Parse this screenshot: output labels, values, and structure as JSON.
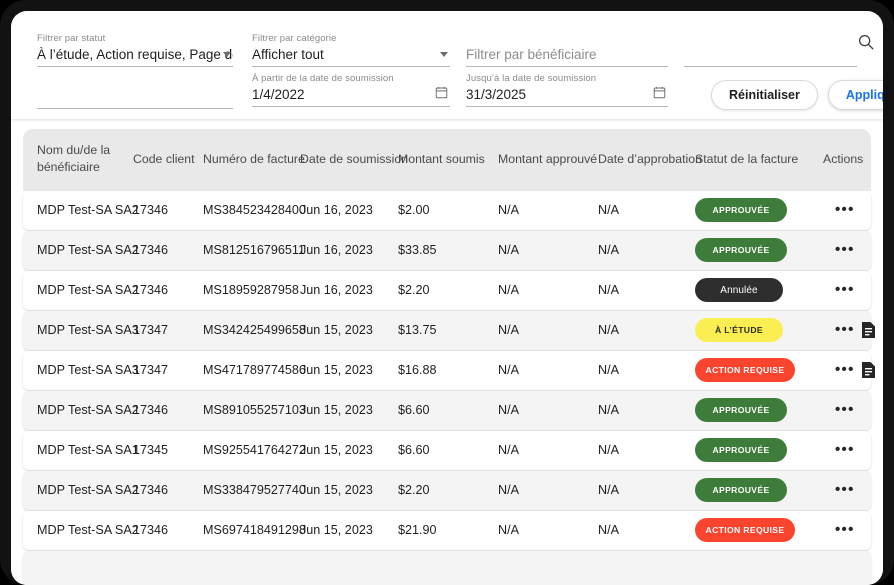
{
  "filters": {
    "status": {
      "label": "Filtrer par statut",
      "value": "À l’étude, Action requise, Page de couvert…"
    },
    "empty_left": {
      "label": "",
      "value": ""
    },
    "category": {
      "label": "Filtrer par catégorie",
      "value": "Afficher tout"
    },
    "date_from": {
      "label": "À partir de la date de soumission",
      "value": "1/4/2022"
    },
    "beneficiary": {
      "label": "",
      "placeholder": "Filtrer par bénéficiaire",
      "value": ""
    },
    "date_to": {
      "label": "Jusqu’à la date de soumission",
      "value": "31/3/2025"
    },
    "search": {
      "label": "",
      "placeholder": "",
      "value": "",
      "icon": "search-icon"
    },
    "reset_label": "Réinitialiser",
    "apply_label": "Appliquer"
  },
  "table": {
    "columns": [
      "Nom du/de la bénéficiaire",
      "Code client",
      "Numéro de facture",
      "Date de soumission",
      "Montant soumis",
      "Montant approuvé",
      "Date d’approbation",
      "Statut de la facture",
      "Actions"
    ],
    "rows": [
      {
        "name": "MDP Test-SA SA2",
        "code": "17346",
        "invoice": "MS384523428400",
        "submitted": "Jun 16, 2023",
        "amount": "$2.00",
        "approved_amount": "N/A",
        "approval_date": "N/A",
        "status": "APPROUVÉE",
        "status_kind": "approved",
        "has_doc": false
      },
      {
        "name": "MDP Test-SA SA2",
        "code": "17346",
        "invoice": "MS812516796511",
        "submitted": "Jun 16, 2023",
        "amount": "$33.85",
        "approved_amount": "N/A",
        "approval_date": "N/A",
        "status": "APPROUVÉE",
        "status_kind": "approved",
        "has_doc": false
      },
      {
        "name": "MDP Test-SA SA2",
        "code": "17346",
        "invoice": "MS18959287958",
        "submitted": "Jun 16, 2023",
        "amount": "$2.20",
        "approved_amount": "N/A",
        "approval_date": "N/A",
        "status": "Annulée",
        "status_kind": "cancelled",
        "has_doc": false
      },
      {
        "name": "MDP Test-SA SA3",
        "code": "17347",
        "invoice": "MS342425499658",
        "submitted": "Jun 15, 2023",
        "amount": "$13.75",
        "approved_amount": "N/A",
        "approval_date": "N/A",
        "status": "À L’ÉTUDE",
        "status_kind": "review",
        "has_doc": true
      },
      {
        "name": "MDP Test-SA SA3",
        "code": "17347",
        "invoice": "MS471789774586",
        "submitted": "Jun 15, 2023",
        "amount": "$16.88",
        "approved_amount": "N/A",
        "approval_date": "N/A",
        "status": "ACTION REQUISE",
        "status_kind": "action",
        "has_doc": true
      },
      {
        "name": "MDP Test-SA SA2",
        "code": "17346",
        "invoice": "MS891055257103",
        "submitted": "Jun 15, 2023",
        "amount": "$6.60",
        "approved_amount": "N/A",
        "approval_date": "N/A",
        "status": "APPROUVÉE",
        "status_kind": "approved",
        "has_doc": false
      },
      {
        "name": "MDP Test-SA SA1",
        "code": "17345",
        "invoice": "MS925541764272",
        "submitted": "Jun 15, 2023",
        "amount": "$6.60",
        "approved_amount": "N/A",
        "approval_date": "N/A",
        "status": "APPROUVÉE",
        "status_kind": "approved",
        "has_doc": false
      },
      {
        "name": "MDP Test-SA SA2",
        "code": "17346",
        "invoice": "MS338479527740",
        "submitted": "Jun 15, 2023",
        "amount": "$2.20",
        "approved_amount": "N/A",
        "approval_date": "N/A",
        "status": "APPROUVÉE",
        "status_kind": "approved",
        "has_doc": false
      },
      {
        "name": "MDP Test-SA SA2",
        "code": "17346",
        "invoice": "MS697418491298",
        "submitted": "Jun 15, 2023",
        "amount": "$21.90",
        "approved_amount": "N/A",
        "approval_date": "N/A",
        "status": "ACTION REQUISE",
        "status_kind": "action",
        "has_doc": false
      },
      {
        "name": "",
        "code": "",
        "invoice": "",
        "submitted": "",
        "amount": "",
        "approved_amount": "",
        "approval_date": "",
        "status": "",
        "status_kind": "review",
        "has_doc": false
      }
    ],
    "action_menu_glyph": "•••"
  },
  "colors": {
    "approved": "#3d7c3a",
    "cancelled": "#2e2e2e",
    "review": "#fbee52",
    "action": "#f9442e",
    "accent_blue": "#1a73e8",
    "header_bg": "#e9e9e9",
    "row_alt_bg": "#f4f4f4"
  }
}
